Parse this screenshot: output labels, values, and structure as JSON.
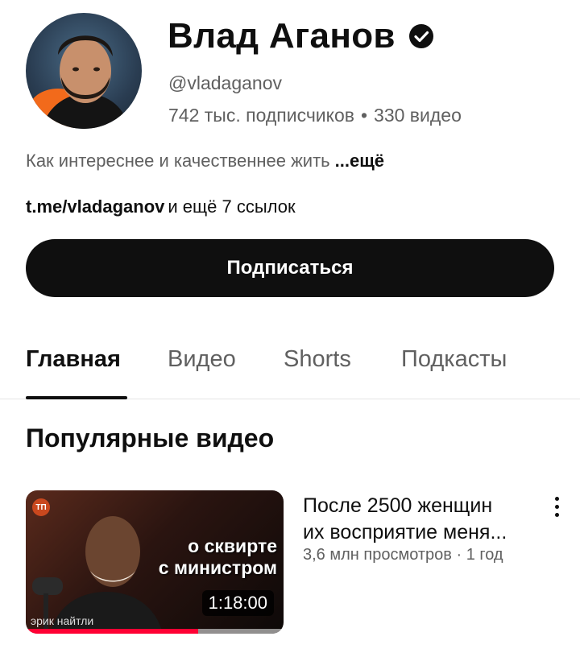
{
  "channel": {
    "name": "Влад Аганов",
    "handle": "@vladaganov",
    "subscribers": "742 тыс. подписчиков",
    "separator": "•",
    "video_count": "330 видео",
    "description": "Как интереснее и качественнее жить",
    "description_more": "...ещё",
    "link": "t.me/vladaganov",
    "link_extra": "и ещё 7 ссылок",
    "verified_icon": "verified-checkmark-icon"
  },
  "subscribe": {
    "label": "Подписаться"
  },
  "tabs": [
    {
      "label": "Главная",
      "active": true
    },
    {
      "label": "Видео",
      "active": false
    },
    {
      "label": "Shorts",
      "active": false
    },
    {
      "label": "Подкасты",
      "active": false
    }
  ],
  "section": {
    "title": "Популярные видео"
  },
  "videos": [
    {
      "title_line1": "После 2500 женщин",
      "title_line2": "их восприятие меня...",
      "meta": "3,6 млн просмотров · 1 год",
      "duration": "1:18:00",
      "thumbnail_caption_line1": "о сквирте",
      "thumbnail_caption_line2": "с министром",
      "thumbnail_name": "эрик найтли",
      "thumbnail_logo": "ТП",
      "watched_fraction": 0.67
    }
  ],
  "colors": {
    "accent": "#ff0033",
    "text": "#0f0f0f",
    "secondary": "#606060",
    "button": "#0f0f0f"
  }
}
